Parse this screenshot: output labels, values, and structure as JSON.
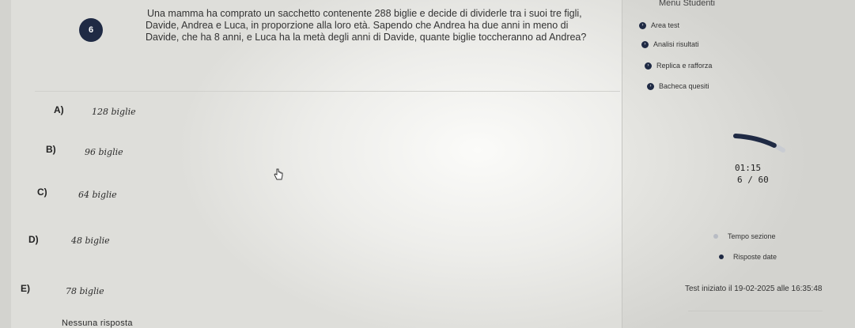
{
  "question": {
    "number": "6",
    "lines": [
      "Una mamma ha comprato un sacchetto contenente 288 biglie e decide di dividerle tra i suoi tre figli,",
      "Davide, Andrea e Luca, in proporzione alla loro età. Sapendo che Andrea ha due anni in meno di",
      "Davide, che ha 8 anni, e Luca ha la metà degli anni di Davide, quante biglie toccheranno ad Andrea?"
    ]
  },
  "options": [
    {
      "letter": "A)",
      "text": "128 biglie"
    },
    {
      "letter": "B)",
      "text": "96 biglie"
    },
    {
      "letter": "C)",
      "text": "64 biglie"
    },
    {
      "letter": "D)",
      "text": "48 biglie"
    },
    {
      "letter": "E)",
      "text": "78 biglie"
    }
  ],
  "no_answer": "Nessuna risposta",
  "sidebar": {
    "title": "Menu Studenti",
    "items": [
      {
        "label": "Area test"
      },
      {
        "label": "Analisi risultati"
      },
      {
        "label": "Replica e rafforza"
      },
      {
        "label": "Bacheca quesiti"
      }
    ],
    "timer": "01:15",
    "progress_text": "6 / 60",
    "progress_fraction": 0.1,
    "legend": [
      {
        "label": "Tempo sezione",
        "color": "#b8bcc4"
      },
      {
        "label": "Risposte date",
        "color": "#1f2a44"
      }
    ],
    "started": "Test iniziato il 19-02-2025 alle 16:35:48"
  }
}
